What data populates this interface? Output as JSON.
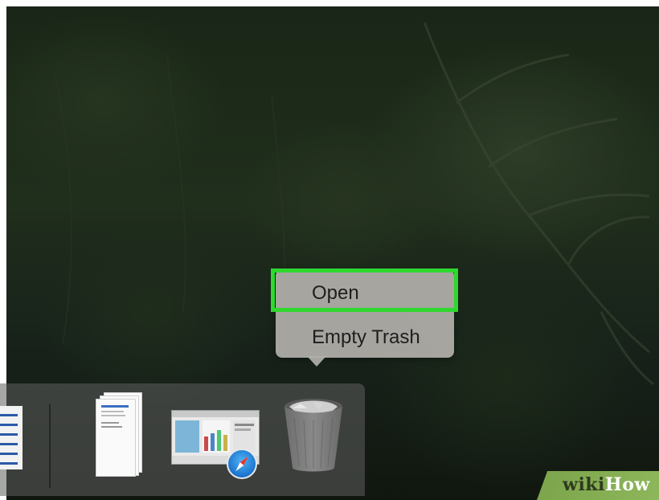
{
  "context_menu": {
    "items": [
      {
        "label": "Open",
        "highlighted": true
      },
      {
        "label": "Empty Trash",
        "highlighted": false
      }
    ],
    "highlight_color": "#2fd82f"
  },
  "dock": {
    "items": [
      {
        "name": "document",
        "icon": "document-icon"
      },
      {
        "name": "divider"
      },
      {
        "name": "stacked-documents",
        "icon": "document-stack-icon"
      },
      {
        "name": "safari-window",
        "icon": "safari-compass-icon"
      },
      {
        "name": "trash",
        "icon": "trash-icon",
        "state": "full"
      }
    ]
  },
  "watermark": {
    "prefix": "wiki",
    "suffix": "How"
  }
}
